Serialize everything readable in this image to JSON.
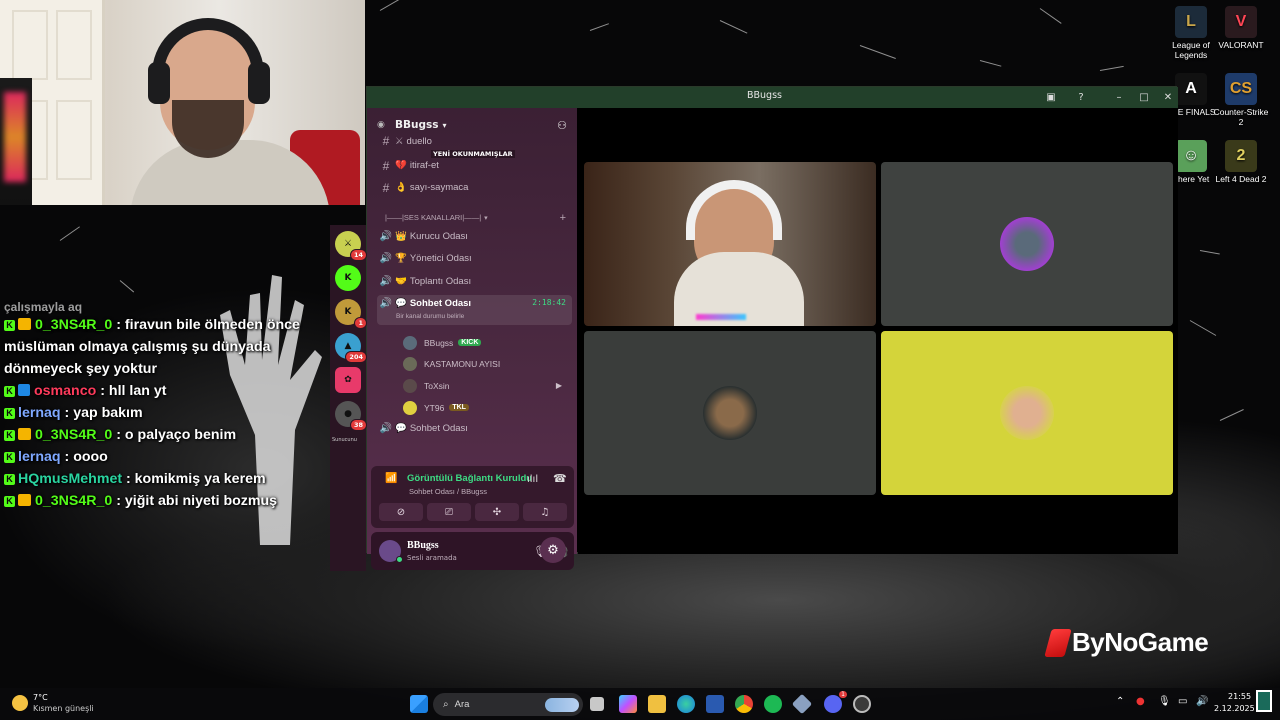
{
  "desktop_icons": [
    {
      "label": "League of Legends",
      "icon": "league-of-legends-icon",
      "color": "#1c2b3a"
    },
    {
      "label": "VALORANT",
      "icon": "valorant-icon",
      "color": "#ff4655"
    },
    {
      "label": "THE FINALS",
      "icon": "the-finals-icon",
      "color": "#d8d8d8"
    },
    {
      "label": "Counter-Strike 2",
      "icon": "counter-strike-icon",
      "color": "#e0a030"
    },
    {
      "label": "There Yet",
      "icon": "there-yet-icon",
      "color": "#5aa05a"
    },
    {
      "label": "Left 4 Dead 2",
      "icon": "left4dead-icon",
      "color": "#b59a3a"
    }
  ],
  "chat": {
    "partial_top": "çalışmayla aq",
    "messages": [
      {
        "user": "0_3NS4R_0",
        "color": "#53fc18",
        "badge": "crown",
        "text": "firavun bile ölmeden önce müslüman olmaya çalışmış şu dünyada dönmeyeck şey yoktur"
      },
      {
        "user": "osmanco",
        "color": "#ff3b5c",
        "badge": "blue",
        "text": "hll lan yt"
      },
      {
        "user": "lernaq",
        "color": "#7fa8ff",
        "badge": "none",
        "text": "yap bakım"
      },
      {
        "user": "0_3NS4R_0",
        "color": "#53fc18",
        "badge": "crown",
        "text": "o palyaço benim"
      },
      {
        "user": "lernaq",
        "color": "#7fa8ff",
        "badge": "none",
        "text": "oooo"
      },
      {
        "user": "HQmusMehmet",
        "color": "#2ad4a0",
        "badge": "none",
        "text": "komikmiş ya kerem"
      },
      {
        "user": "0_3NS4R_0",
        "color": "#53fc18",
        "badge": "crown",
        "text": "yiğit abi niyeti bozmuş"
      }
    ]
  },
  "discord": {
    "window_title": "BBugss",
    "server_name": "BBugss",
    "unread_label": "YENİ OKUNMAMIŞLAR",
    "text_channels": [
      {
        "name": "duello",
        "emoji": "⚔"
      },
      {
        "name": "itiraf-et",
        "emoji": "💔"
      },
      {
        "name": "sayı-saymaca",
        "emoji": "👌"
      }
    ],
    "voice_category": "|——|SES KANALLARI|——|",
    "voice_channels": [
      {
        "name": "Kurucu Odası",
        "emoji": "👑"
      },
      {
        "name": "Yönetici Odası",
        "emoji": "🏆"
      },
      {
        "name": "Toplantı Odası",
        "emoji": "🤝"
      },
      {
        "name": "Sohbet Odası",
        "emoji": "💬",
        "timer": "2:18:42",
        "status": "Bir kanal durumu belirle"
      },
      {
        "name": "Sohbet Odası",
        "emoji": "💬"
      }
    ],
    "members": [
      {
        "name": "BBugss",
        "tag": "KICK",
        "tag_color": "#2fa84f",
        "avatar": "#5a6b7a"
      },
      {
        "name": "KASTAMONU AYISI",
        "tag": "",
        "tag_color": "",
        "avatar": "#6a6a58"
      },
      {
        "name": "ToXsin",
        "tag": "",
        "tag_color": "",
        "avatar": "#5a4a4a"
      },
      {
        "name": "YT96",
        "tag": "TKL",
        "tag_color": "#7a5a20",
        "avatar": "#e0d040"
      }
    ],
    "guild_badges": [
      "14",
      "",
      "1",
      "204",
      "",
      "38"
    ],
    "guild_side_label": "Sunucunu",
    "voice_panel": {
      "title": "Görüntülü Bağlantı Kuruldu",
      "subtitle": "Sohbet Odası / BBugss"
    },
    "user_panel": {
      "name": "BBugss",
      "status": "Sesli aramada"
    },
    "tile_colors": {
      "top_right": "#3f4240",
      "bottom_left": "#3a3d3b",
      "bottom_right": "#d4d43a"
    }
  },
  "taskbar": {
    "weather_temp": "7°C",
    "weather_desc": "Kısmen güneşli",
    "search_placeholder": "Ara",
    "time": "21:55",
    "date": "2.12.2025",
    "discord_badge": "1"
  },
  "watermark": "ByNoGame",
  "colors": {
    "discord_bg": "#4c2a42",
    "accent_green": "#3ddc84",
    "kick_green": "#53fc18",
    "titlebar": "#22402a"
  }
}
